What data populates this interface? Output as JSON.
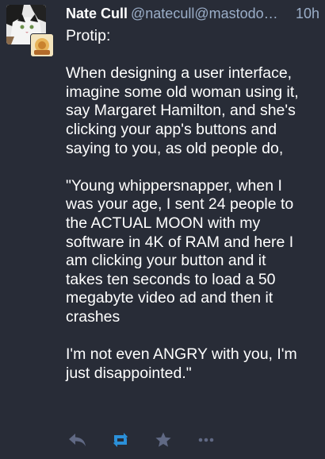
{
  "status": {
    "display_name": "Nate Cull",
    "account": "@natecull@mastodo…",
    "timestamp": "10h",
    "content": {
      "paragraphs": [
        {
          "lines": [
            "Protip:"
          ]
        },
        {
          "lines": [
            "When designing a user interface,",
            "imagine some old woman using it,",
            "say Margaret Hamilton, and she's",
            "clicking your app's buttons and",
            "saying to you, as old people do,"
          ]
        },
        {
          "lines": [
            "\"Young whippersnapper, when I",
            "was your age, I sent 24 people to",
            "the ACTUAL MOON with my",
            "software in 4K of RAM and here I",
            "am clicking your button and it",
            "takes ten seconds to load a 50",
            "megabyte video ad and then it",
            "crashes"
          ]
        },
        {
          "lines": [
            "I'm not even ANGRY with you, I'm",
            "just disappointed.\""
          ]
        }
      ]
    },
    "actions": {
      "reply_icon": "reply-icon",
      "boost_icon": "boost-icon",
      "favourite_icon": "star-icon",
      "more_icon": "ellipsis-icon"
    }
  },
  "colors": {
    "background": "#282c37",
    "text": "#ffffff",
    "secondary": "#9baec8",
    "action_icon": "#606984",
    "boost_active": "#2b90d9"
  }
}
